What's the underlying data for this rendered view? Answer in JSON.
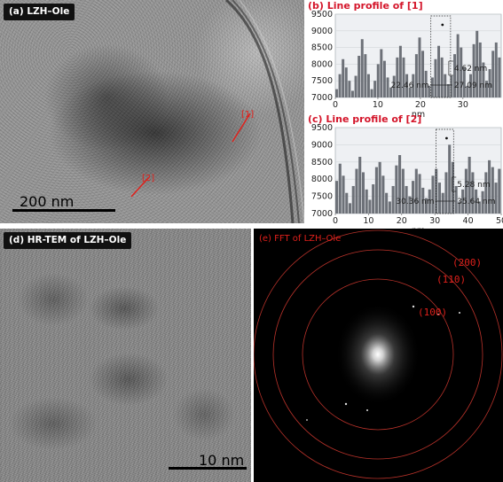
{
  "panel_a": {
    "label": "(a) LZH–Ole",
    "scale_bar": "200 nm",
    "marker_1": "[1]",
    "marker_2": "[2]"
  },
  "panel_b": {
    "title": "(b) Line profile of [1]",
    "annotation_width": "4.62 nm",
    "annotation_left": "22.46 nm",
    "annotation_right": "27.09 nm"
  },
  "panel_c": {
    "title": "(c) Line profile of [2]",
    "annotation_width": "5.28 nm",
    "annotation_left": "30.36 nm",
    "annotation_right": "35.64 nm"
  },
  "panel_d": {
    "label": "(d) HR-TEM of LZH–Ole",
    "scale_bar": "10 nm"
  },
  "panel_e": {
    "label": "(e) FFT of LZH–Ole",
    "ring_labels": [
      "(200)",
      "(110)",
      "(100)"
    ]
  },
  "chart_data": [
    {
      "type": "bar",
      "title": "(b) Line profile of [1]",
      "xlabel": "nm",
      "ylabel": "",
      "xlim": [
        0,
        39
      ],
      "ylim": [
        7000,
        9500
      ],
      "xticks": [
        0,
        10,
        20,
        30
      ],
      "yticks": [
        7000,
        7500,
        8000,
        8500,
        9000,
        9500
      ],
      "x": [
        0.0,
        0.75,
        1.5,
        2.25,
        3.0,
        3.75,
        4.5,
        5.25,
        6.0,
        6.75,
        7.5,
        8.25,
        9.0,
        9.75,
        10.5,
        11.25,
        12.0,
        12.75,
        13.5,
        14.25,
        15.0,
        15.75,
        16.5,
        17.25,
        18.0,
        18.75,
        19.5,
        20.25,
        21.0,
        21.75,
        22.5,
        23.25,
        24.0,
        24.75,
        25.5,
        26.25,
        27.0,
        27.75,
        28.5,
        29.25,
        30.0,
        30.75,
        31.5,
        32.25,
        33.0,
        33.75,
        34.5,
        35.25,
        36.0,
        36.75,
        37.5,
        38.25
      ],
      "values": [
        7250,
        7700,
        8150,
        7900,
        7500,
        7200,
        7650,
        8250,
        8750,
        8300,
        7700,
        7250,
        7500,
        8000,
        8450,
        8100,
        7600,
        7300,
        7650,
        8200,
        8550,
        8200,
        7700,
        7300,
        7700,
        8300,
        8800,
        8400,
        7800,
        7350,
        7600,
        8150,
        8550,
        8200,
        7700,
        7400,
        7650,
        8300,
        8900,
        8500,
        7900,
        7350,
        7700,
        8600,
        9000,
        8650,
        8050,
        7500,
        7850,
        8400,
        8650,
        8200
      ],
      "guide_lines_x": [
        22.46,
        27.09
      ]
    },
    {
      "type": "bar",
      "title": "(c) Line profile of [2]",
      "xlabel": "nm",
      "ylabel": "",
      "xlim": [
        0,
        50
      ],
      "ylim": [
        7000,
        9500
      ],
      "xticks": [
        0,
        10,
        20,
        30,
        40,
        50
      ],
      "yticks": [
        7000,
        7500,
        8000,
        8500,
        9000,
        9500
      ],
      "x": [
        0.0,
        1.0,
        2.0,
        3.0,
        4.0,
        5.0,
        6.0,
        7.0,
        8.0,
        9.0,
        10.0,
        11.0,
        12.0,
        13.0,
        14.0,
        15.0,
        16.0,
        17.0,
        18.0,
        19.0,
        20.0,
        21.0,
        22.0,
        23.0,
        24.0,
        25.0,
        26.0,
        27.0,
        28.0,
        29.0,
        30.0,
        31.0,
        32.0,
        33.0,
        34.0,
        35.0,
        36.0,
        37.0,
        38.0,
        39.0,
        40.0,
        41.0,
        42.0,
        43.0,
        44.0,
        45.0,
        46.0,
        47.0,
        48.0,
        49.0
      ],
      "values": [
        7950,
        8450,
        8100,
        7600,
        7300,
        7800,
        8300,
        8650,
        8200,
        7700,
        7400,
        7850,
        8350,
        8500,
        8100,
        7600,
        7350,
        7800,
        8400,
        8700,
        8300,
        7800,
        7500,
        7950,
        8300,
        8150,
        7750,
        7450,
        7700,
        8100,
        8300,
        7900,
        7600,
        8200,
        9000,
        8500,
        7800,
        7350,
        7700,
        8300,
        8650,
        8200,
        7700,
        7350,
        7650,
        8200,
        8550,
        8350,
        7900,
        8300
      ],
      "guide_lines_x": [
        30.36,
        35.64
      ]
    }
  ]
}
